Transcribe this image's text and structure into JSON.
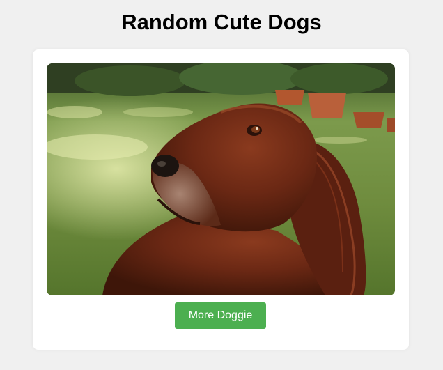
{
  "page": {
    "title": "Random Cute Dogs"
  },
  "card": {
    "image_subject": "irish-setter-dog-photo",
    "button_label": "More Doggie"
  },
  "colors": {
    "background": "#f0f0f0",
    "card": "#ffffff",
    "button": "#4caf50",
    "button_text": "#ffffff"
  }
}
